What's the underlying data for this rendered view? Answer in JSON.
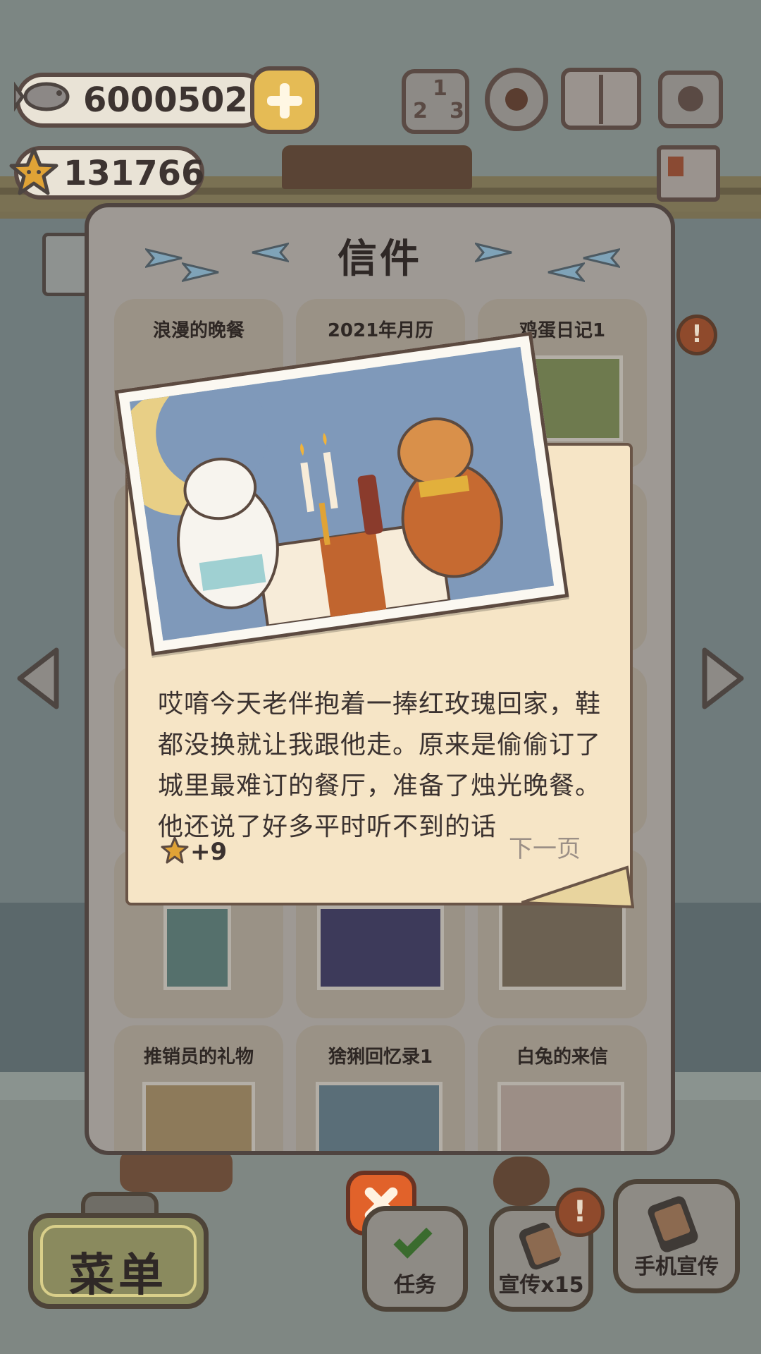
{
  "currency": {
    "fish": "6000502",
    "stars": "131766"
  },
  "top_icons": {
    "ranking": [
      "1",
      "2",
      "3"
    ]
  },
  "panel": {
    "title": "信件",
    "letters": [
      {
        "label": "浪漫的晚餐"
      },
      {
        "label": "2021年月历"
      },
      {
        "label": "鸡蛋日记1"
      },
      {
        "label": "推销员的礼物"
      },
      {
        "label": "猞猁回忆录1"
      },
      {
        "label": "白兔的来信"
      }
    ]
  },
  "letter_popup": {
    "text": "哎唷今天老伴抱着一捧红玫瑰回家，鞋都没换就让我跟他走。原来是偷偷订了城里最难订的餐厅，准备了烛光晚餐。他还说了好多平时听不到的话",
    "reward": "+9",
    "next_page": "下一页"
  },
  "bottom": {
    "menu": "菜单",
    "task": "任务",
    "promo": "宣传x15",
    "phone_promo": "手机宣传",
    "alert": "!"
  },
  "colors": {
    "panel_border": "#4f4440",
    "close_button": "#e1622a",
    "paper": "#f6e5c6"
  }
}
